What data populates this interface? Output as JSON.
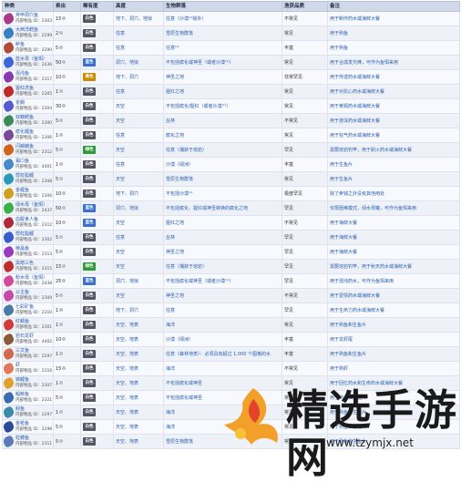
{
  "table": {
    "headers": {
      "name": "种类",
      "price": "卖出",
      "rarity": "稀有度",
      "height": "高度",
      "biome": "生物群落",
      "catch": "渔获品质",
      "note": "备注"
    },
    "rows": [
      {
        "name": "斧甲洞穴鱼",
        "id": "内部物品 ID：2303",
        "price": "15",
        "rarity": "白色",
        "rarity_color": "#555566",
        "height": "地下、洞穴、地狱",
        "biome": "任意（沙漠⁽¹⁾除外）",
        "catch": "不常见",
        "note": "用于制作药水或海鲜大餐",
        "icon_color": "#a83a8a"
      },
      {
        "name": "大西洋鳕鱼",
        "id": "内部物品 ID：2299",
        "price": "2",
        "rarity": "白色",
        "rarity_color": "#555566",
        "height": "任意",
        "biome": "雪原生物群落",
        "catch": "常见",
        "note": "用于熟鱼",
        "icon_color": "#3a7fc0"
      },
      {
        "name": "鲈鱼",
        "id": "内部物品 ID：2290",
        "price": "5",
        "rarity": "白色",
        "rarity_color": "#555566",
        "height": "任意",
        "biome": "任意⁽¹⁾",
        "catch": "丰富",
        "note": "用于熟鱼",
        "icon_color": "#b04a3a"
      },
      {
        "name": "蓝水母（鱼饵）",
        "id": "内部物品 ID：2436",
        "price": "50",
        "rarity": "蓝色",
        "rarity_color": "#3a6fd0",
        "height": "洞穴、地狱",
        "biome": "不包括腐化或神圣（或者沙漠⁽¹⁾）",
        "catch": "常见",
        "note": "用于合成发光棒，可作为鱼饵来用",
        "icon_color": "#3a66d8"
      },
      {
        "name": "混沌鱼",
        "id": "内部物品 ID：2317",
        "price": "10",
        "rarity": "黄色",
        "rarity_color": "#d08a00",
        "height": "地下、洞穴",
        "biome": "神圣之地",
        "catch": "非常罕见",
        "note": "用于传送药水或海鲜大餐",
        "icon_color": "#8a3ab0"
      },
      {
        "name": "猩红虎鱼",
        "id": "内部物品 ID：2305",
        "price": "1",
        "rarity": "白色",
        "rarity_color": "#555566",
        "height": "任意",
        "biome": "猩红之地",
        "catch": "常见",
        "note": "用于对抗心药水或海鲜大餐",
        "icon_color": "#c02a2a"
      },
      {
        "name": "雀鲷",
        "id": "内部物品 ID：2304",
        "price": "30",
        "rarity": "白色",
        "rarity_color": "#555566",
        "height": "天空",
        "biome": "不包括腐化/猩红（或者沙漠⁽¹⁾）",
        "catch": "常见",
        "note": "用于黄铜药水或海鲜大餐",
        "icon_color": "#5a5ad0"
      },
      {
        "name": "双鳍鳕鱼",
        "id": "内部物品 ID：2300",
        "price": "5",
        "rarity": "白色",
        "rarity_color": "#555566",
        "height": "天空",
        "biome": "丛林",
        "catch": "不常见",
        "note": "用于游泳药水或海鲜大餐",
        "icon_color": "#3a8a5a"
      },
      {
        "name": "腐化鲤鱼",
        "id": "内部物品 ID：2306",
        "price": "1",
        "rarity": "白色",
        "rarity_color": "#555566",
        "height": "任意",
        "biome": "腐化之地",
        "catch": "常见",
        "note": "用于狂气药水或海鲜大餐",
        "icon_color": "#7a4a9a"
      },
      {
        "name": "闪鳞鳍鱼",
        "id": "内部物品 ID：2312",
        "price": "5",
        "rarity": "绿色",
        "rarity_color": "#2f9a3a",
        "height": "天空",
        "biome": "任意（捕获于熔岩）",
        "catch": "罕见",
        "note": "需要熔岩钓竿，用于耐火药水或海鲜大餐",
        "icon_color": "#d0641a"
      },
      {
        "name": "霜口鱼",
        "id": "内部物品 ID：4401",
        "price": "1",
        "rarity": "白色",
        "rarity_color": "#555566",
        "height": "任意",
        "biome": "沙漠（绿洲）",
        "catch": "丰富",
        "note": "用于生鱼片",
        "icon_color": "#4a8ac8"
      },
      {
        "name": "霓虹脂鲤",
        "id": "内部物品 ID：2308",
        "price": "5",
        "rarity": "白色",
        "rarity_color": "#555566",
        "height": "天空",
        "biome": "雪原生物群落",
        "catch": "常见",
        "note": "用于生鱼片",
        "icon_color": "#2a9ab8"
      },
      {
        "name": "金鲤鱼",
        "id": "内部物品 ID：2306",
        "price": "10",
        "rarity": "白色",
        "rarity_color": "#555566",
        "height": "地下、洞穴",
        "biome": "不包括沙漠⁽¹⁾",
        "catch": "极度罕见",
        "note": "除了卖钱之外没有其他用处",
        "icon_color": "#d0a020"
      },
      {
        "name": "绿水母（鱼饵）",
        "id": "内部物品 ID：2437",
        "price": "50",
        "rarity": "蓝色",
        "rarity_color": "#3a6fd0",
        "height": "洞穴、地狱",
        "biome": "不包括腐化、猩红或神圣转换的腐化之地",
        "catch": "罕见",
        "note": "仅限困难模式，绿水母罐，可作为鱼饵来用",
        "icon_color": "#3ab04a"
      },
      {
        "name": "血腥食人鱼",
        "id": "内部物品 ID：2312",
        "price": "10",
        "rarity": "蓝色",
        "rarity_color": "#3a6fd0",
        "height": "天空",
        "biome": "猩红之地",
        "catch": "不常见",
        "note": "用于海鲜大餐",
        "icon_color": "#b02a3a"
      },
      {
        "name": "霓虹脂鲤",
        "id": "内部物品 ID：2302",
        "price": "5",
        "rarity": "白色",
        "rarity_color": "#555566",
        "height": "任意",
        "biome": "丛林",
        "catch": "罕见",
        "note": "用于海鲜大餐",
        "icon_color": "#3a5ad0"
      },
      {
        "name": "棱晶鱼",
        "id": "内部物品 ID：2313",
        "price": "5",
        "rarity": "白色",
        "rarity_color": "#555566",
        "height": "天空",
        "biome": "神圣之地",
        "catch": "罕见",
        "note": "用于海鲜大餐",
        "icon_color": "#9a3ac0"
      },
      {
        "name": "黑暗三色",
        "id": "内部物品 ID：2315",
        "price": "15",
        "rarity": "绿色",
        "rarity_color": "#2f9a3a",
        "height": "天空",
        "biome": "任意（捕获于熔岩）",
        "catch": "罕见",
        "note": "需要熔岩钓竿，用于秋天药水或海鲜大餐",
        "icon_color": "#c0302a"
      },
      {
        "name": "粉水母（鱼饵）",
        "id": "内部物品 ID：2438",
        "price": "25",
        "rarity": "蓝色",
        "rarity_color": "#3a6fd0",
        "height": "洞穴、地狱",
        "biome": "不包括腐化或神圣（或者沙漠⁽¹⁾）",
        "catch": "罕见",
        "note": "用于混沌药水，可作为鱼饵来用",
        "icon_color": "#d04a9a"
      },
      {
        "name": "公主鱼",
        "id": "内部物品 ID：2309",
        "price": "5",
        "rarity": "白色",
        "rarity_color": "#555566",
        "height": "天空",
        "biome": "神圣之地",
        "catch": "不常见",
        "note": "用于爱情药水或海鲜大餐",
        "icon_color": "#c84aa8"
      },
      {
        "name": "七彩矿鱼",
        "id": "内部物品 ID：2310",
        "price": "1",
        "rarity": "白色",
        "rarity_color": "#555566",
        "height": "地下、洞穴",
        "biome": "任意",
        "catch": "罕见",
        "note": "用于生命力药水或海鲜大餐",
        "icon_color": "#4a7aa8"
      },
      {
        "name": "红鲷鱼",
        "id": "内部物品 ID：2301",
        "price": "1",
        "rarity": "白色",
        "rarity_color": "#555566",
        "height": "天空、地表",
        "biome": "海洋",
        "catch": "常见",
        "note": "用于熟鱼和生鱼片",
        "icon_color": "#d03a3a"
      },
      {
        "name": "岩石龙虾",
        "id": "内部物品 ID：4402",
        "price": "10",
        "rarity": "白色",
        "rarity_color": "#555566",
        "height": "天空、地表",
        "biome": "沙漠（绿洲）",
        "catch": "丰富",
        "note": "用于龙虾尾",
        "icon_color": "#8a5a3a"
      },
      {
        "name": "三文鱼",
        "id": "内部物品 ID：2297",
        "price": "1",
        "rarity": "白色",
        "rarity_color": "#555566",
        "height": "天空、地表",
        "biome": "任意（森林地表）：必须具有超过 1,000 个图格的水",
        "catch": "丰富",
        "note": "用于熟鱼和生鱼片",
        "icon_color": "#d06a4a"
      },
      {
        "name": "虾",
        "id": "内部物品 ID：2316",
        "price": "15",
        "rarity": "白色",
        "rarity_color": "#555566",
        "height": "天空、地表",
        "biome": "海洋",
        "catch": "不常见",
        "note": "用于熟虾",
        "icon_color": "#e07a5a"
      },
      {
        "name": "锦鲤鱼",
        "id": "内部物品 ID：2307",
        "price": "1",
        "rarity": "白色",
        "rarity_color": "#555566",
        "height": "天空、地表",
        "biome": "不包括腐化或神圣",
        "catch": "常见",
        "note": "用于回忆药水和生命药水或海鲜大餐",
        "icon_color": "#e0a030"
      },
      {
        "name": "鲳鲹鱼",
        "id": "内部物品 ID：2321",
        "price": "5",
        "rarity": "白色",
        "rarity_color": "#555566",
        "height": "天空、地表",
        "biome": "不包括腐化或神圣",
        "catch": "常见",
        "note": "用于熟鱼和生鱼片",
        "icon_color": "#3a6ab0"
      },
      {
        "name": "鲟鱼",
        "id": "内部物品 ID：2297",
        "price": "1",
        "rarity": "白色",
        "rarity_color": "#555566",
        "height": "天空、地表",
        "biome": "海洋",
        "catch": "常见",
        "note": "用于熟鱼和生鱼片",
        "icon_color": "#3a8aa8"
      },
      {
        "name": "金枪鱼",
        "id": "内部物品 ID：2298",
        "price": "5",
        "rarity": "白色",
        "rarity_color": "#555566",
        "height": "天空、地表",
        "biome": "海洋",
        "catch": "常见",
        "note": "用于熟鱼和生鱼片",
        "icon_color": "#2a4a9a"
      },
      {
        "name": "虹鳟鱼",
        "id": "内部物品 ID：2311",
        "price": "5",
        "rarity": "白色",
        "rarity_color": "#555566",
        "height": "天空、地表",
        "biome": "雪原生物群落",
        "catch": "常见",
        "note": "用于熟鱼和生鱼片",
        "icon_color": "#5a7ab8"
      }
    ]
  },
  "watermark": {
    "title": "精选手游网",
    "url": "www.tzymjx.net"
  }
}
